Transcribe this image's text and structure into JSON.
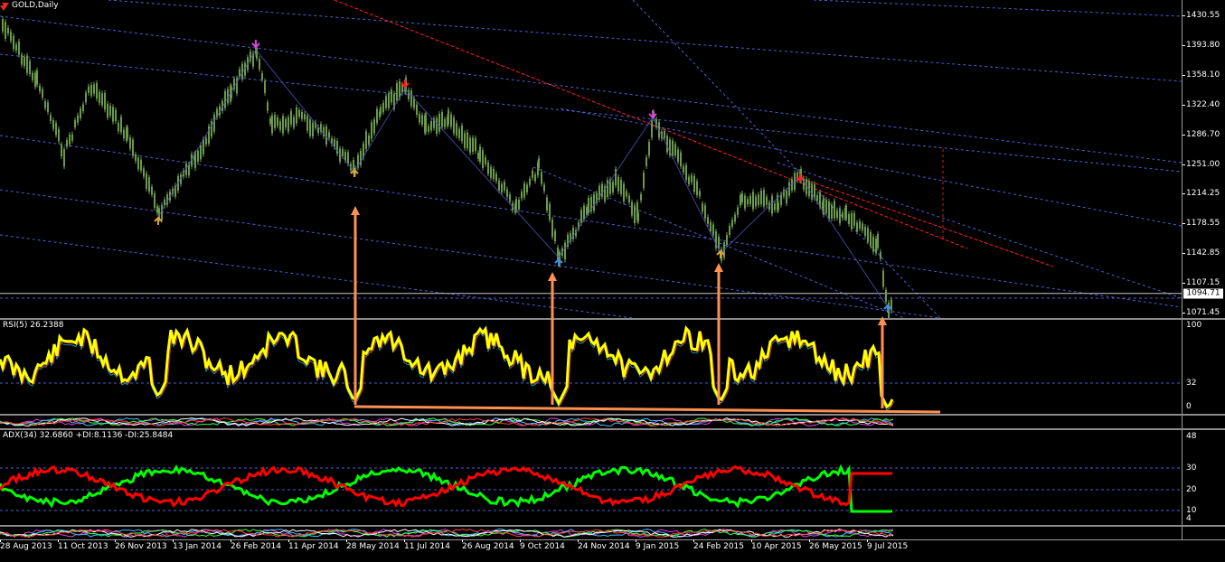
{
  "main_chart": {
    "title": "GOLD,Daily",
    "price_axis": [
      "1430.55",
      "1393.80",
      "1358.10",
      "1322.40",
      "1286.70",
      "1251.00",
      "1214.25",
      "1178.55",
      "1142.85",
      "1107.15",
      "1071.45"
    ],
    "current_price": "1094.71"
  },
  "rsi_panel": {
    "label": "RSI(5) 26.2388",
    "axis": [
      "100",
      "32",
      "0"
    ]
  },
  "adx_panel": {
    "label": "ADX(34) 32.6860 +DI:8.1136 -DI:25.8484",
    "axis": [
      "48",
      "30",
      "20",
      "10",
      "4"
    ]
  },
  "x_axis": [
    "28 Aug 2013",
    "11 Oct 2013",
    "26 Nov 2013",
    "13 Jan 2014",
    "26 Feb 2014",
    "11 Apr 2014",
    "28 May 2014",
    "11 Jul 2014",
    "26 Aug 2014",
    "9 Oct 2014",
    "24 Nov 2014",
    "9 Jan 2015",
    "24 Feb 2015",
    "10 Apr 2015",
    "26 May 2015",
    "9 Jul 2015"
  ],
  "chart_data": {
    "type": "line",
    "title": "GOLD,Daily",
    "series": [
      {
        "name": "GOLD,Daily",
        "x": [
          "28 Aug 2013",
          "11 Oct 2013",
          "26 Nov 2013",
          "13 Jan 2014",
          "26 Feb 2014",
          "11 Apr 2014",
          "28 May 2014",
          "11 Jul 2014",
          "26 Aug 2014",
          "9 Oct 2014",
          "24 Nov 2014",
          "9 Jan 2015",
          "24 Feb 2015",
          "10 Apr 2015",
          "26 May 2015",
          "9 Jul 2015"
        ],
        "values": [
          1415,
          1290,
          1230,
          1250,
          1332,
          1310,
          1258,
          1340,
          1285,
          1225,
          1175,
          1250,
          1215,
          1207,
          1212,
          1100
        ]
      }
    ],
    "ylim": [
      1071.45,
      1430.55
    ],
    "grid": false
  },
  "colors": {
    "candles": "#6b9b4a",
    "rsi": "#ffff00",
    "adx_plus": "#00ff00",
    "adx_minus": "#ff0000",
    "trend_blue": "#4a5fd0",
    "trend_red": "#ff2020",
    "annotation": "#ff9050"
  }
}
